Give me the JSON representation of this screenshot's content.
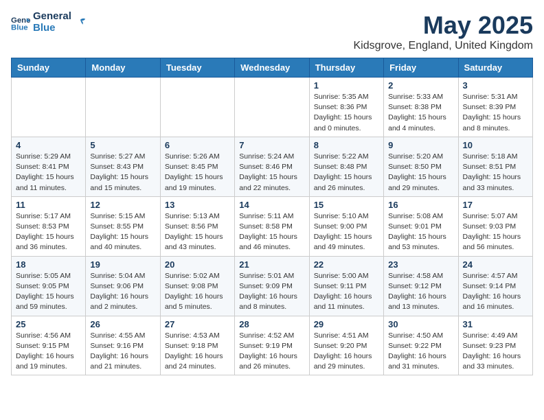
{
  "logo": {
    "line1": "General",
    "line2": "Blue"
  },
  "title": "May 2025",
  "subtitle": "Kidsgrove, England, United Kingdom",
  "days_of_week": [
    "Sunday",
    "Monday",
    "Tuesday",
    "Wednesday",
    "Thursday",
    "Friday",
    "Saturday"
  ],
  "weeks": [
    [
      {
        "day": "",
        "info": ""
      },
      {
        "day": "",
        "info": ""
      },
      {
        "day": "",
        "info": ""
      },
      {
        "day": "",
        "info": ""
      },
      {
        "day": "1",
        "info": "Sunrise: 5:35 AM\nSunset: 8:36 PM\nDaylight: 15 hours\nand 0 minutes."
      },
      {
        "day": "2",
        "info": "Sunrise: 5:33 AM\nSunset: 8:38 PM\nDaylight: 15 hours\nand 4 minutes."
      },
      {
        "day": "3",
        "info": "Sunrise: 5:31 AM\nSunset: 8:39 PM\nDaylight: 15 hours\nand 8 minutes."
      }
    ],
    [
      {
        "day": "4",
        "info": "Sunrise: 5:29 AM\nSunset: 8:41 PM\nDaylight: 15 hours\nand 11 minutes."
      },
      {
        "day": "5",
        "info": "Sunrise: 5:27 AM\nSunset: 8:43 PM\nDaylight: 15 hours\nand 15 minutes."
      },
      {
        "day": "6",
        "info": "Sunrise: 5:26 AM\nSunset: 8:45 PM\nDaylight: 15 hours\nand 19 minutes."
      },
      {
        "day": "7",
        "info": "Sunrise: 5:24 AM\nSunset: 8:46 PM\nDaylight: 15 hours\nand 22 minutes."
      },
      {
        "day": "8",
        "info": "Sunrise: 5:22 AM\nSunset: 8:48 PM\nDaylight: 15 hours\nand 26 minutes."
      },
      {
        "day": "9",
        "info": "Sunrise: 5:20 AM\nSunset: 8:50 PM\nDaylight: 15 hours\nand 29 minutes."
      },
      {
        "day": "10",
        "info": "Sunrise: 5:18 AM\nSunset: 8:51 PM\nDaylight: 15 hours\nand 33 minutes."
      }
    ],
    [
      {
        "day": "11",
        "info": "Sunrise: 5:17 AM\nSunset: 8:53 PM\nDaylight: 15 hours\nand 36 minutes."
      },
      {
        "day": "12",
        "info": "Sunrise: 5:15 AM\nSunset: 8:55 PM\nDaylight: 15 hours\nand 40 minutes."
      },
      {
        "day": "13",
        "info": "Sunrise: 5:13 AM\nSunset: 8:56 PM\nDaylight: 15 hours\nand 43 minutes."
      },
      {
        "day": "14",
        "info": "Sunrise: 5:11 AM\nSunset: 8:58 PM\nDaylight: 15 hours\nand 46 minutes."
      },
      {
        "day": "15",
        "info": "Sunrise: 5:10 AM\nSunset: 9:00 PM\nDaylight: 15 hours\nand 49 minutes."
      },
      {
        "day": "16",
        "info": "Sunrise: 5:08 AM\nSunset: 9:01 PM\nDaylight: 15 hours\nand 53 minutes."
      },
      {
        "day": "17",
        "info": "Sunrise: 5:07 AM\nSunset: 9:03 PM\nDaylight: 15 hours\nand 56 minutes."
      }
    ],
    [
      {
        "day": "18",
        "info": "Sunrise: 5:05 AM\nSunset: 9:05 PM\nDaylight: 15 hours\nand 59 minutes."
      },
      {
        "day": "19",
        "info": "Sunrise: 5:04 AM\nSunset: 9:06 PM\nDaylight: 16 hours\nand 2 minutes."
      },
      {
        "day": "20",
        "info": "Sunrise: 5:02 AM\nSunset: 9:08 PM\nDaylight: 16 hours\nand 5 minutes."
      },
      {
        "day": "21",
        "info": "Sunrise: 5:01 AM\nSunset: 9:09 PM\nDaylight: 16 hours\nand 8 minutes."
      },
      {
        "day": "22",
        "info": "Sunrise: 5:00 AM\nSunset: 9:11 PM\nDaylight: 16 hours\nand 11 minutes."
      },
      {
        "day": "23",
        "info": "Sunrise: 4:58 AM\nSunset: 9:12 PM\nDaylight: 16 hours\nand 13 minutes."
      },
      {
        "day": "24",
        "info": "Sunrise: 4:57 AM\nSunset: 9:14 PM\nDaylight: 16 hours\nand 16 minutes."
      }
    ],
    [
      {
        "day": "25",
        "info": "Sunrise: 4:56 AM\nSunset: 9:15 PM\nDaylight: 16 hours\nand 19 minutes."
      },
      {
        "day": "26",
        "info": "Sunrise: 4:55 AM\nSunset: 9:16 PM\nDaylight: 16 hours\nand 21 minutes."
      },
      {
        "day": "27",
        "info": "Sunrise: 4:53 AM\nSunset: 9:18 PM\nDaylight: 16 hours\nand 24 minutes."
      },
      {
        "day": "28",
        "info": "Sunrise: 4:52 AM\nSunset: 9:19 PM\nDaylight: 16 hours\nand 26 minutes."
      },
      {
        "day": "29",
        "info": "Sunrise: 4:51 AM\nSunset: 9:20 PM\nDaylight: 16 hours\nand 29 minutes."
      },
      {
        "day": "30",
        "info": "Sunrise: 4:50 AM\nSunset: 9:22 PM\nDaylight: 16 hours\nand 31 minutes."
      },
      {
        "day": "31",
        "info": "Sunrise: 4:49 AM\nSunset: 9:23 PM\nDaylight: 16 hours\nand 33 minutes."
      }
    ]
  ]
}
